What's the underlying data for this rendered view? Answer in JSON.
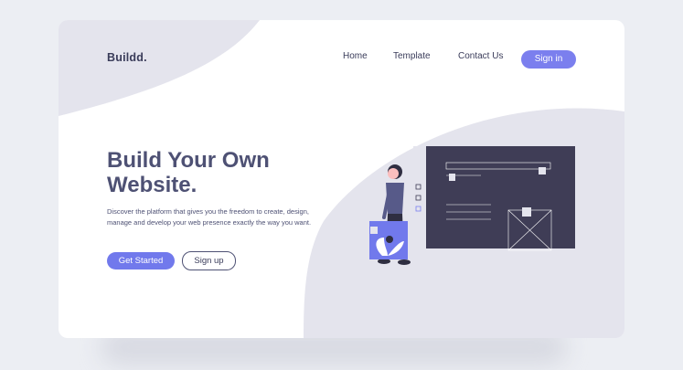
{
  "header": {
    "brand": "Buildd.",
    "nav": [
      "Home",
      "Template",
      "Contact Us"
    ],
    "signin_label": "Sign in"
  },
  "hero": {
    "title": "Build Your Own Website.",
    "description": "Discover the platform that gives you the freedom to create, design, manage and develop your web presence exactly the way you want.",
    "primary_button": "Get Started",
    "secondary_button": "Sign up"
  },
  "colors": {
    "accent": "#7b7fee",
    "text_dark": "#3a3c5a",
    "heading": "#4e5174",
    "panel_dark": "#3f3d56",
    "blob": "#e4e4ed"
  },
  "illustration_icons": [
    "person-icon",
    "website-window-icon",
    "image-placeholder-icon",
    "plant-card-icon"
  ]
}
